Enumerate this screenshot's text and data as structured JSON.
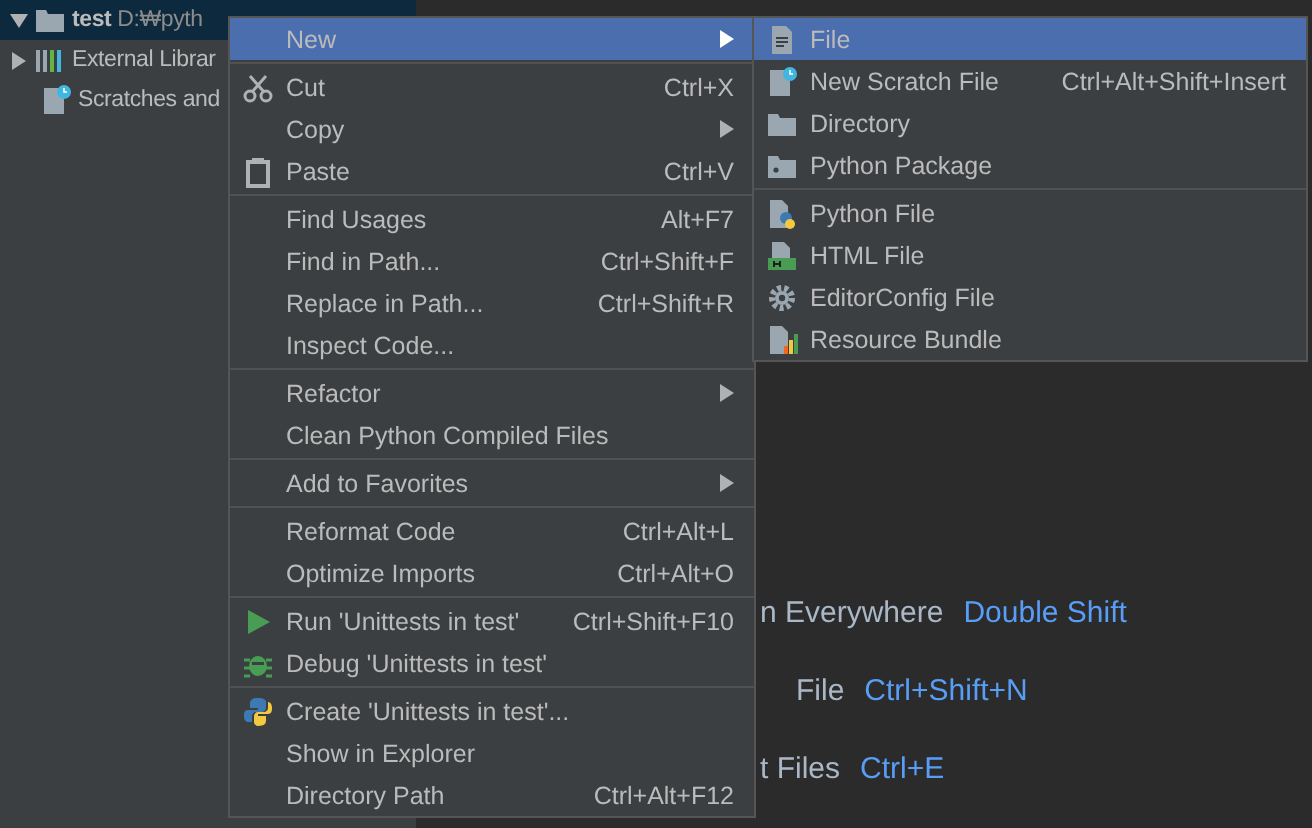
{
  "project_tree": {
    "items": [
      {
        "label": "test",
        "path": "D:₩pyth",
        "expanded": true,
        "selected": true,
        "kind": "folder"
      },
      {
        "label": "External Librar",
        "expanded": false,
        "selected": false,
        "kind": "library"
      },
      {
        "label": "Scratches and",
        "selected": false,
        "kind": "scratch"
      }
    ]
  },
  "editor_hints": [
    {
      "label": "n Everywhere",
      "shortcut": "Double Shift"
    },
    {
      "label": "File",
      "shortcut": "Ctrl+Shift+N"
    },
    {
      "label": "t Files",
      "shortcut": "Ctrl+E"
    }
  ],
  "context_menu": {
    "groups": [
      [
        {
          "label": "New",
          "selected": true,
          "submenu": true
        }
      ],
      [
        {
          "label": "Cut",
          "shortcut": "Ctrl+X",
          "kind": "scissors",
          "selected": false
        },
        {
          "label": "Copy",
          "submenu": true,
          "selected": false
        },
        {
          "label": "Paste",
          "shortcut": "Ctrl+V",
          "kind": "clipboard",
          "selected": false
        }
      ],
      [
        {
          "label": "Find Usages",
          "shortcut": "Alt+F7",
          "selected": false
        },
        {
          "label": "Find in Path...",
          "shortcut": "Ctrl+Shift+F",
          "selected": false
        },
        {
          "label": "Replace in Path...",
          "shortcut": "Ctrl+Shift+R",
          "selected": false
        },
        {
          "label": "Inspect Code...",
          "selected": false
        }
      ],
      [
        {
          "label": "Refactor",
          "submenu": true,
          "selected": false
        },
        {
          "label": "Clean Python Compiled Files",
          "selected": false
        }
      ],
      [
        {
          "label": "Add to Favorites",
          "submenu": true,
          "selected": false
        }
      ],
      [
        {
          "label": "Reformat Code",
          "shortcut": "Ctrl+Alt+L",
          "selected": false
        },
        {
          "label": "Optimize Imports",
          "shortcut": "Ctrl+Alt+O",
          "selected": false
        }
      ],
      [
        {
          "label": "Run 'Unittests in test'",
          "shortcut": "Ctrl+Shift+F10",
          "kind": "run",
          "selected": false
        },
        {
          "label": "Debug 'Unittests in test'",
          "kind": "bug",
          "selected": false
        }
      ],
      [
        {
          "label": "Create 'Unittests in test'...",
          "kind": "python",
          "selected": false
        },
        {
          "label": "Show in Explorer",
          "selected": false
        },
        {
          "label": "Directory Path",
          "shortcut": "Ctrl+Alt+F12",
          "selected": false
        }
      ]
    ]
  },
  "new_submenu": {
    "groups": [
      [
        {
          "label": "File",
          "kind": "file",
          "selected": true
        },
        {
          "label": "New Scratch File",
          "shortcut": "Ctrl+Alt+Shift+Insert",
          "kind": "scratch",
          "selected": false
        },
        {
          "label": "Directory",
          "kind": "folder",
          "selected": false
        },
        {
          "label": "Python Package",
          "kind": "package",
          "selected": false
        }
      ],
      [
        {
          "label": "Python File",
          "kind": "python-file",
          "selected": false
        },
        {
          "label": "HTML File",
          "kind": "html",
          "selected": false
        },
        {
          "label": "EditorConfig File",
          "kind": "gear",
          "selected": false
        },
        {
          "label": "Resource Bundle",
          "kind": "bundle",
          "selected": false
        }
      ]
    ]
  }
}
